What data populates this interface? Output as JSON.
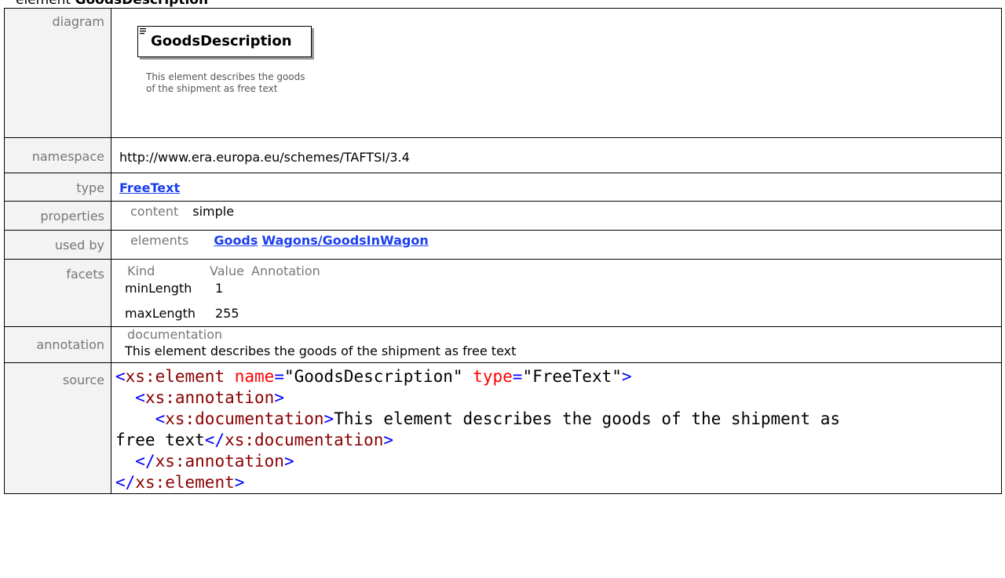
{
  "heading": {
    "prefix": "element ",
    "name": "GoodsDescription"
  },
  "labels": {
    "diagram": "diagram",
    "namespace": "namespace",
    "type": "type",
    "properties": "properties",
    "used_by": "used by",
    "facets": "facets",
    "annotation": "annotation",
    "source": "source"
  },
  "diagram": {
    "element_name": "GoodsDescription",
    "description": "This element describes the goods of the shipment as free text"
  },
  "namespace": "http://www.era.europa.eu/schemes/TAFTSI/3.4",
  "type": "FreeText",
  "properties": {
    "key": "content",
    "value": "simple"
  },
  "used_by": {
    "key": "elements",
    "links": [
      "Goods",
      "Wagons/GoodsInWagon"
    ]
  },
  "facets": {
    "headers": [
      "Kind",
      "Value",
      "Annotation"
    ],
    "rows": [
      {
        "kind": "minLength",
        "value": "1"
      },
      {
        "kind": "maxLength",
        "value": "255"
      }
    ]
  },
  "annotation": {
    "title": "documentation",
    "text": "This element describes the goods of the shipment as free text"
  },
  "source": {
    "lines": [
      {
        "t1": "<",
        "tn": "xs:element",
        "sp": " ",
        "a1": "name",
        "eq1": "=",
        "v1": "\"GoodsDescription\"",
        "sp2": " ",
        "a2": "type",
        "eq2": "=",
        "v2": "\"FreeText\"",
        "end": ">"
      },
      {
        "indent": "  ",
        "t": "<",
        "tn": "xs:annotation",
        "end": ">"
      },
      {
        "indent": "    ",
        "t": "<",
        "tn": "xs:documentation",
        "end": ">",
        "text": "This element describes the goods of the shipment as"
      },
      {
        "text": "free text",
        "t": "</",
        "tn": "xs:documentation",
        "end": ">"
      },
      {
        "indent": "  ",
        "t": "</",
        "tn": "xs:annotation",
        "end": ">"
      },
      {
        "t": "</",
        "tn": "xs:element",
        "end": ">"
      }
    ]
  },
  "colors": {
    "link": "#1b3ef0",
    "label_bg": "#f3f3f3",
    "tag": "#0000ff",
    "tag_name": "#8b0000",
    "attr_name": "#ff0000"
  },
  "icons": [
    "element-lines-icon"
  ]
}
